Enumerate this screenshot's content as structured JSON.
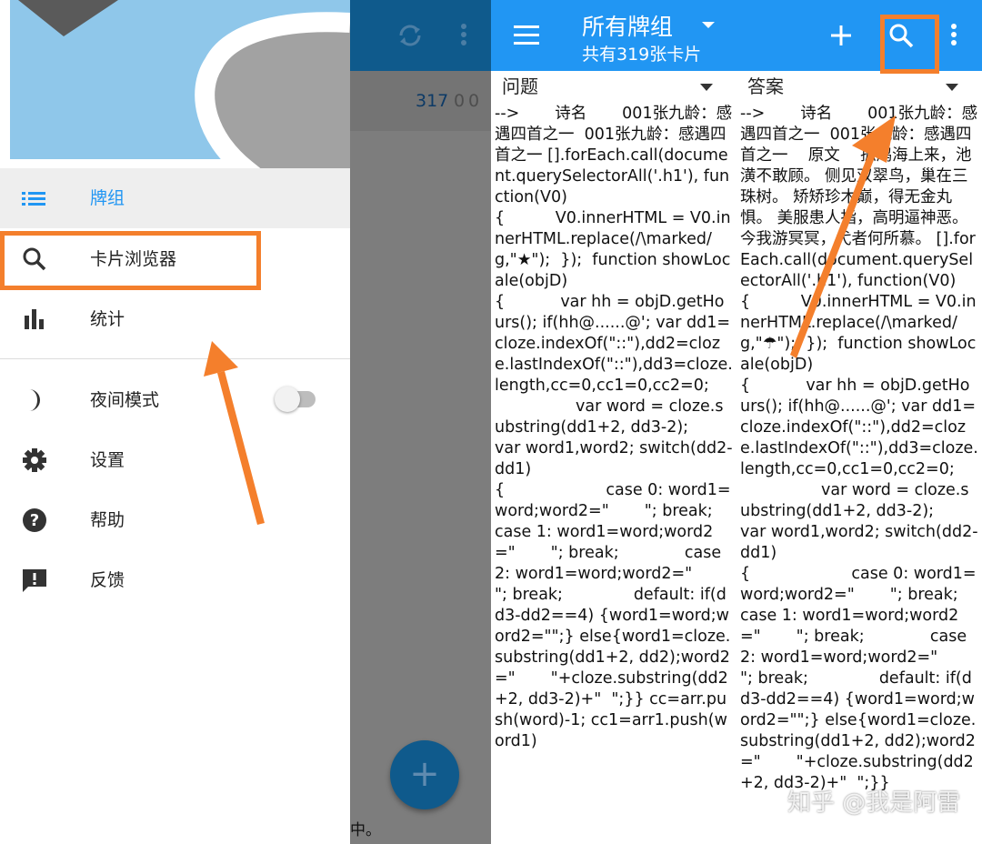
{
  "drawer": {
    "items": [
      {
        "label": "牌组",
        "icon": "list-icon",
        "selected": true
      },
      {
        "label": "卡片浏览器",
        "icon": "search-icon"
      },
      {
        "label": "统计",
        "icon": "bar-chart-icon"
      },
      {
        "label": "夜间模式",
        "icon": "moon-icon",
        "toggle": false
      },
      {
        "label": "设置",
        "icon": "gear-icon"
      },
      {
        "label": "帮助",
        "icon": "help-icon"
      },
      {
        "label": "反馈",
        "icon": "feedback-icon"
      }
    ]
  },
  "main_screen": {
    "deck_counts": {
      "new": "317",
      "learning": "0",
      "review": "0"
    },
    "fab_label": "+",
    "footer_text": "中。"
  },
  "browser": {
    "title": "所有牌组",
    "subtitle": "共有319张卡片",
    "columns": [
      {
        "header": "问题"
      },
      {
        "header": "答案"
      }
    ],
    "question_cell": "-->       诗名       001张九龄：感遇四首之一  001张九龄：感遇四首之一 [].forEach.call(document.querySelectorAll('.h1'), function(V0)\n{          V0.innerHTML = V0.innerHTML.replace(/\\marked/g,\"★\");  });  function showLocale(objD)\n{           var hh = objD.getHours(); if(hh@......@'; var dd1=cloze.indexOf(\"::\"),dd2=cloze.lastIndexOf(\"::\"),dd3=cloze.length,cc=0,cc1=0,cc2=0;\n                var word = cloze.substring(dd1+2, dd3-2);                 var word1,word2; switch(dd2-dd1)\n{                    case 0: word1=word;word2=\"       \"; break;             case 1: word1=word;word2=\"       \"; break;             case 2: word1=word;word2=\"       \"; break;              default: if(dd3-dd2==4) {word1=word;word2=\"\";} else{word1=cloze.substring(dd1+2, dd2);word2=\"       \"+cloze.substring(dd2+2, dd3-2)+\"  \";}} cc=arr.push(word)-1; cc1=arr1.push(word1)",
    "answer_cell": "-->       诗名       001张九龄：感遇四首之一  001张九龄：感遇四首之一    原文    孤鸿海上来，池潢不敢顾。 侧见双翠鸟，巢在三珠树。 矫矫珍木巅，得无金丸惧。 美服患人指，高明逼神恶。 今我游冥冥，弋者何所慕。 [].forEach.call(document.querySelectorAll('.h1'), function(V0)\n{          V0.innerHTML = V0.innerHTML.replace(/\\marked/g,\"☂\");  });  function showLocale(objD)\n{           var hh = objD.getHours(); if(hh@......@'; var dd1=cloze.indexOf(\"::\"),dd2=cloze.lastIndexOf(\"::\"),dd3=cloze.length,cc=0,cc1=0,cc2=0;\n                var word = cloze.substring(dd1+2, dd3-2);                 var word1,word2; switch(dd2-dd1)\n{                    case 0: word1=word;word2=\"       \"; break;             case 1: word1=word;word2=\"       \"; break;             case 2: word1=word;word2=\"       \"; break;              default: if(dd3-dd2==4) {word1=word;word2=\"\";} else{word1=cloze.substring(dd1+2, dd2);word2=\"       \"+cloze.substring(dd2+2, dd3-2)+\"  \";}}"
  },
  "watermark": "知乎 @我是阿雷",
  "colors": {
    "primary": "#2196f3",
    "primary_dim": "#0f5a8c",
    "annotation": "#f47f2c",
    "drawer_selected_bg": "#eeeeee"
  }
}
